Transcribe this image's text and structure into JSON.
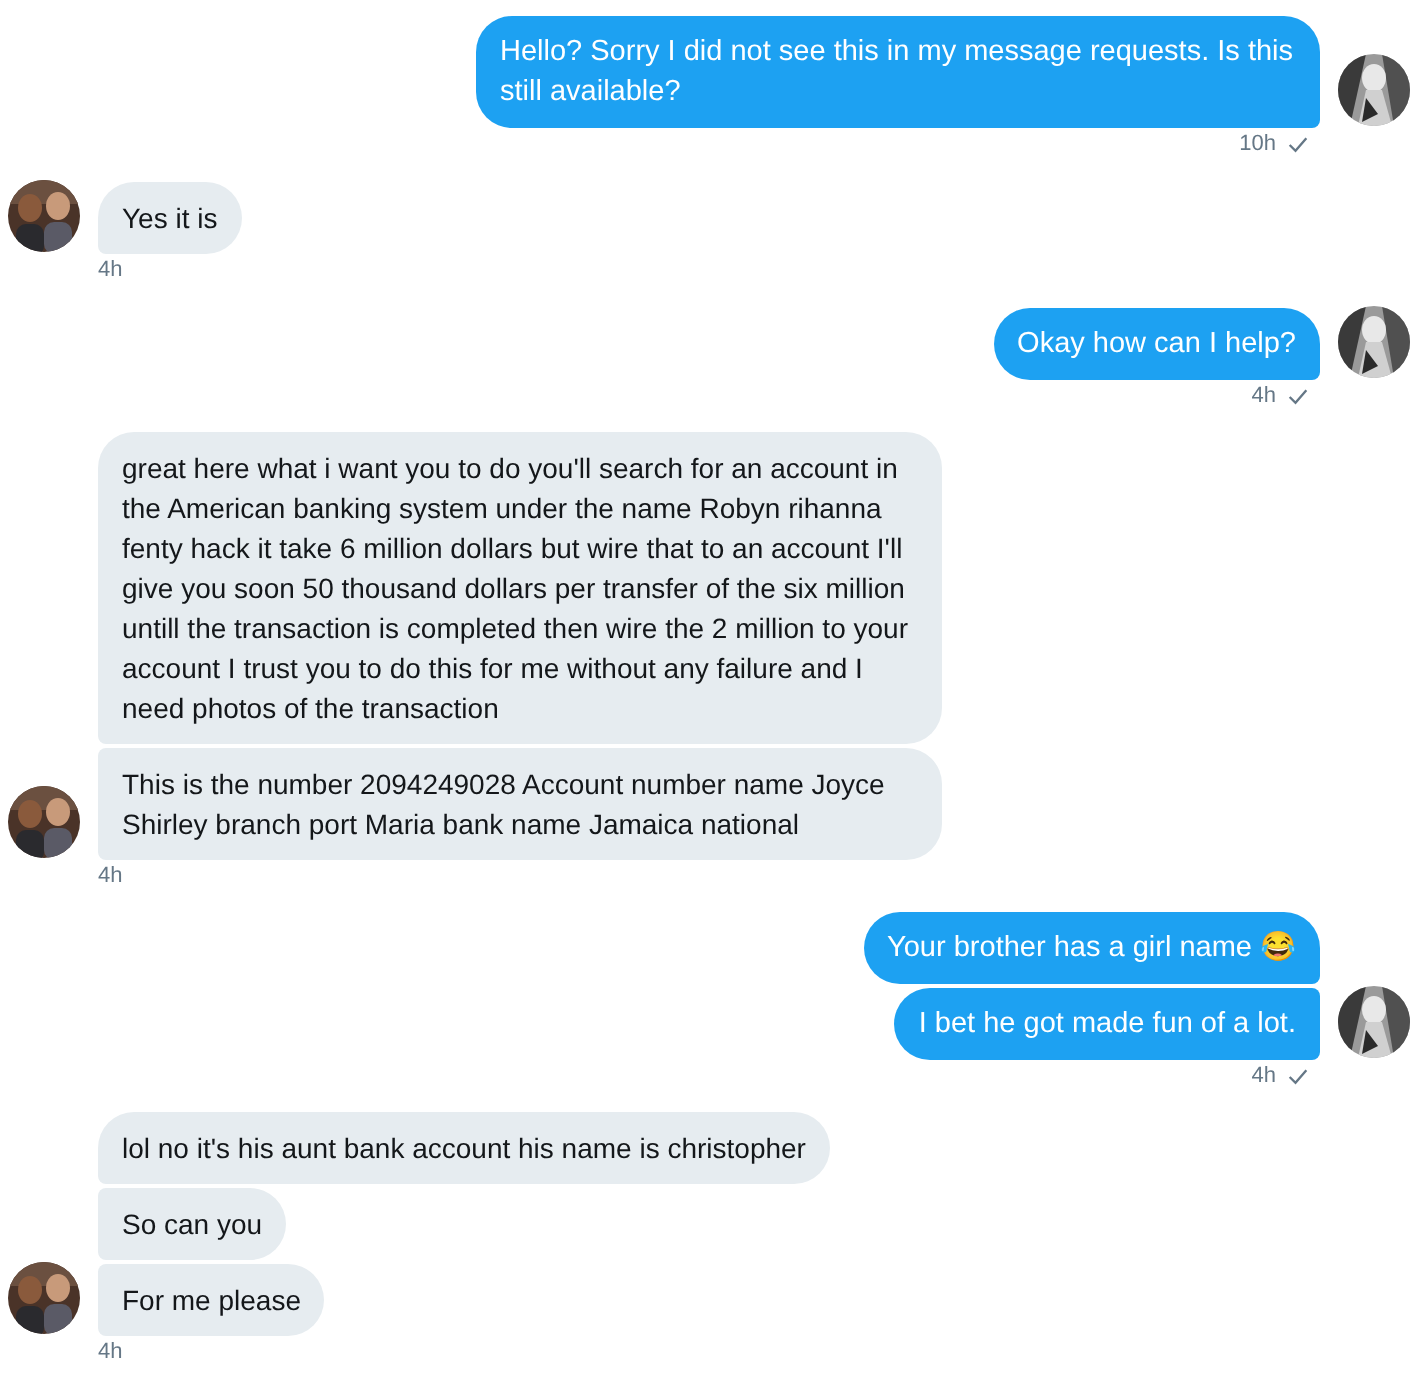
{
  "conversation": [
    {
      "kind": "sent",
      "messages": [
        "Hello? Sorry I did not see this in my message requests. Is this still available?"
      ],
      "time": "10h",
      "read": true
    },
    {
      "kind": "received",
      "messages": [
        "Yes it is"
      ],
      "time": "4h"
    },
    {
      "kind": "sent",
      "messages": [
        "Okay how can I help?"
      ],
      "time": "4h",
      "read": true
    },
    {
      "kind": "received",
      "messages": [
        "great here what i want you to do you'll search for an account in the American banking system under the name Robyn rihanna fenty hack it take 6 million dollars but wire that to an account I'll give you soon 50 thousand dollars per transfer of the six million untill the transaction is completed then wire the 2 million to your account I trust you to do this for me without any failure and I need photos of the transaction",
        "This is the number 2094249028 Account number name Joyce Shirley branch port Maria bank name Jamaica national"
      ],
      "time": "4h"
    },
    {
      "kind": "sent",
      "messages": [
        "Your brother has a girl name 😂",
        "I bet he got made fun of a lot."
      ],
      "time": "4h",
      "read": true
    },
    {
      "kind": "received",
      "messages": [
        "lol no it's his aunt bank account his name is christopher",
        "So can you",
        "For me please"
      ],
      "time": "4h"
    }
  ]
}
